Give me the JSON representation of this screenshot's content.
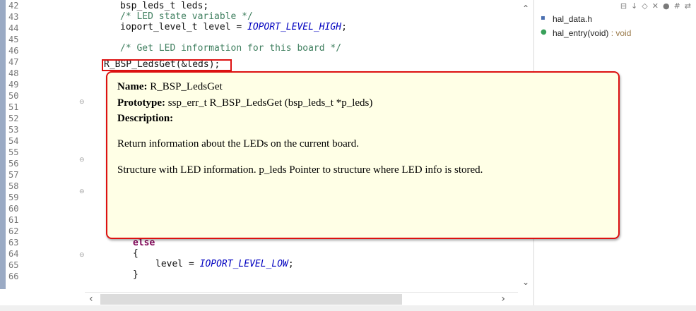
{
  "editor": {
    "line_numbers": [
      "42",
      "43",
      "44",
      "45",
      "46",
      "47",
      "48",
      "49",
      "50",
      "51",
      "52",
      "53",
      "54",
      "55",
      "56",
      "57",
      "58",
      "59",
      "60",
      "61",
      "62",
      "63",
      "64",
      "65",
      "66"
    ],
    "code": {
      "l42": "bsp_leds_t leds;",
      "l43_comment": "/* LED state variable */",
      "l44_prefix": "ioport_level_t level = ",
      "l44_const": "IOPORT_LEVEL_HIGH",
      "l44_suffix": ";",
      "l46_comment": "/* Get LED information for this board */",
      "l47": "R_BSP_LedsGet(&leds);",
      "l62_kw": "else",
      "l63": "{",
      "l64_prefix": "level = ",
      "l64_const": "IOPORT_LEVEL_LOW",
      "l64_suffix": ";",
      "l65": "}"
    }
  },
  "tooltip": {
    "name_label": "Name:",
    "name_value": " R_BSP_LedsGet",
    "prototype_label": "Prototype:",
    "prototype_value": " ssp_err_t R_BSP_LedsGet (bsp_leds_t *p_leds)",
    "description_label": "Description:",
    "description_text": "Return information about the LEDs on the current board.",
    "param_text": "Structure with LED information. p_leds Pointer to structure where LED info is stored."
  },
  "outline": {
    "items": [
      {
        "label": "hal_data.h",
        "icon": "include-file-icon"
      },
      {
        "label": "hal_entry(void)",
        "type": " : void",
        "icon": "function-icon"
      }
    ]
  },
  "colors": {
    "highlight_border": "#dd1111",
    "tooltip_bg": "#ffffe6",
    "comment": "#3f7f5f",
    "constant": "#0000c0",
    "keyword": "#7f0055"
  }
}
